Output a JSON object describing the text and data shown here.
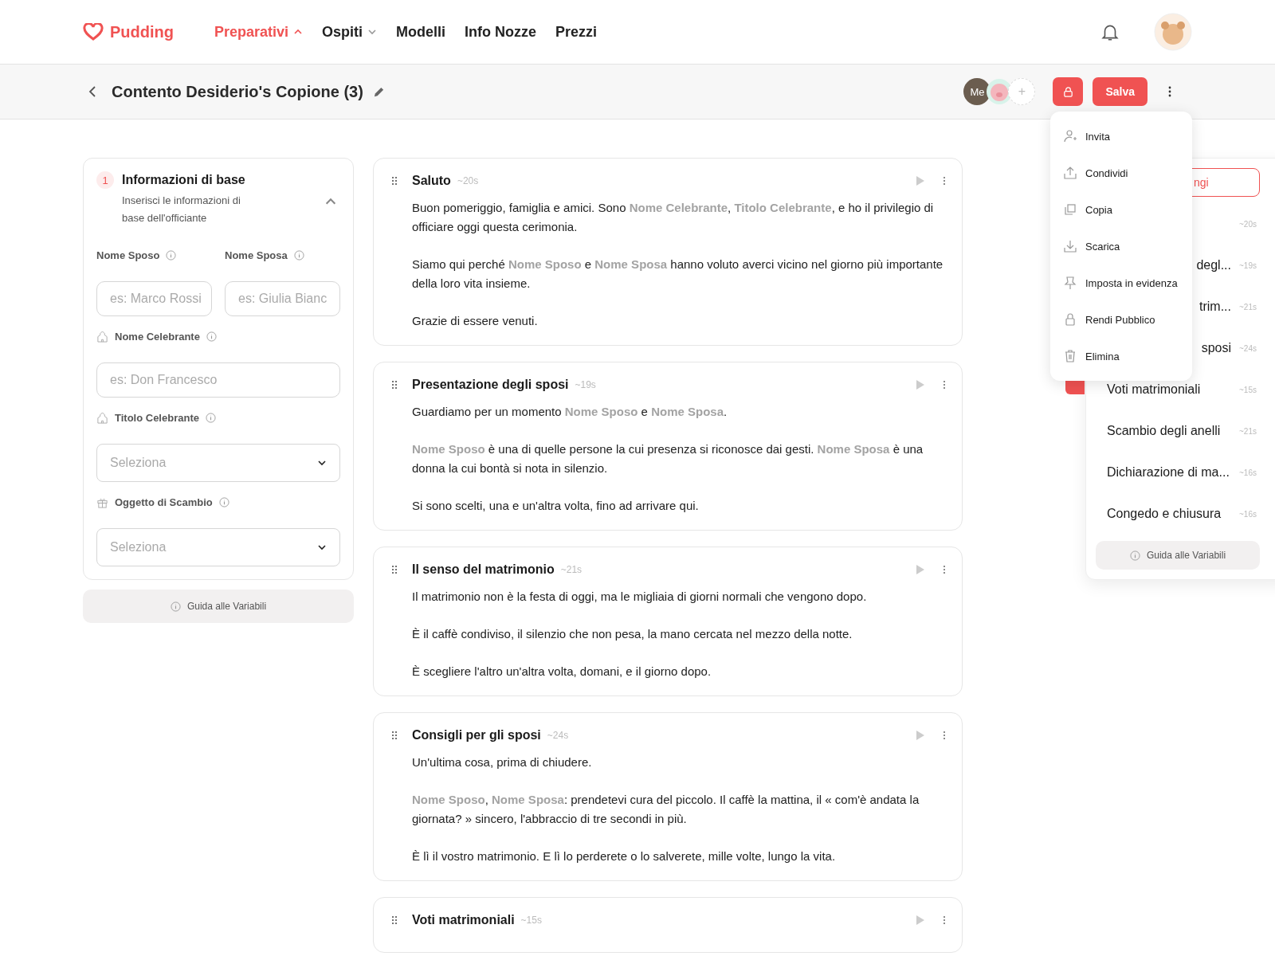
{
  "logo": {
    "text": "Pudding"
  },
  "nav": [
    {
      "label": "Preparativi",
      "kind": "dropdown",
      "selected": true,
      "expanded": true
    },
    {
      "label": "Ospiti",
      "kind": "dropdown",
      "selected": false,
      "expanded": false
    },
    {
      "label": "Modelli",
      "kind": "link",
      "selected": false
    },
    {
      "label": "Info Nozze",
      "kind": "link",
      "selected": false
    },
    {
      "label": "Prezzi",
      "kind": "link",
      "selected": false
    }
  ],
  "toolbar": {
    "title": "Contento Desiderio's Copione (3)",
    "collaborators": [
      {
        "kind": "me",
        "label": "Me"
      },
      {
        "kind": "pig"
      }
    ],
    "add_label": "+",
    "save_label": "Salva"
  },
  "form": {
    "step": "1",
    "title": "Informazioni di base",
    "subtitle": "Inserisci le informazioni di base dell'officiante",
    "expanded": true,
    "fields": [
      {
        "kind": "input",
        "label": "Nome Sposo",
        "placeholder": "es: Marco Rossi"
      },
      {
        "kind": "input",
        "label": "Nome Sposa",
        "placeholder": "es: Giulia Bianc"
      },
      {
        "kind": "input",
        "label": "Nome Celebrante",
        "placeholder": "es: Don Francesco"
      },
      {
        "kind": "select",
        "label": "Titolo Celebrante",
        "placeholder": "Seleziona"
      },
      {
        "kind": "select",
        "label": "Oggetto di Scambio",
        "placeholder": "Seleziona"
      }
    ],
    "help_label": "Guida alle Variabili"
  },
  "sections": [
    {
      "title": "Saluto",
      "duration": "~20s",
      "paragraphs": [
        "Buon pomeriggio, famiglia e amici. Sono **Nome Celebrante**, **Titolo Celebrante**, e ho il privilegio di officiare oggi questa cerimonia.",
        "Siamo qui perché **Nome Sposo** e **Nome Sposa** hanno voluto averci vicino nel giorno più importante della loro vita insieme.",
        "Grazie di essere venuti."
      ]
    },
    {
      "title": "Presentazione degli sposi",
      "duration": "~19s",
      "paragraphs": [
        "Guardiamo per un momento **Nome Sposo** e **Nome Sposa**.",
        "**Nome Sposo** è una di quelle persone la cui presenza si riconosce dai gesti. **Nome Sposa** è una donna la cui bontà si nota in silenzio.",
        "Si sono scelti, una e un'altra volta, fino ad arrivare qui."
      ]
    },
    {
      "title": "Il senso del matrimonio",
      "duration": "~21s",
      "paragraphs": [
        "Il matrimonio non è la festa di oggi, ma le migliaia di giorni normali che vengono dopo.",
        "È il caffè condiviso, il silenzio che non pesa, la mano cercata nel mezzo della notte.",
        "È scegliere l'altro un'altra volta, domani, e il giorno dopo."
      ]
    },
    {
      "title": "Consigli per gli sposi",
      "duration": "~24s",
      "paragraphs": [
        "Un'ultima cosa, prima di chiudere.",
        "**Nome Sposo**, **Nome Sposa**: prendetevi cura del piccolo. Il caffè la mattina, il « com'è andata la giornata? » sincero, l'abbraccio di tre secondi in più.",
        "È lì il vostro matrimonio. E lì lo perderete o lo salverete, mille volte, lungo la vita."
      ]
    },
    {
      "title": "Voti matrimoniali",
      "duration": "~15s"
    }
  ],
  "outline": {
    "add_label": "ngi",
    "items": [
      {
        "kind": "hidden",
        "duration": "~20s",
        "selected": false
      },
      {
        "kind": "partial",
        "title": "degl...",
        "duration": "~19s",
        "selected": false
      },
      {
        "kind": "partial",
        "title": "trim...",
        "duration": "~21s",
        "selected": false
      },
      {
        "kind": "partial",
        "title": "sposi",
        "duration": "~24s",
        "selected": false
      },
      {
        "kind": "full",
        "title": "Voti matrimoniali",
        "duration": "~15s",
        "selected": true
      },
      {
        "kind": "full",
        "title": "Scambio degli anelli",
        "duration": "~21s",
        "selected": false
      },
      {
        "kind": "full",
        "title": "Dichiarazione di ma...",
        "duration": "~16s",
        "selected": false
      },
      {
        "kind": "full",
        "title": "Congedo e chiusura",
        "duration": "~16s",
        "selected": false
      }
    ],
    "help_label": "Guida alle Variabili"
  },
  "menu": {
    "items": [
      "Invita",
      "Condividi",
      "Copia",
      "Scarica",
      "Imposta in evidenza",
      "Rendi Pubblico",
      "Elimina"
    ]
  }
}
